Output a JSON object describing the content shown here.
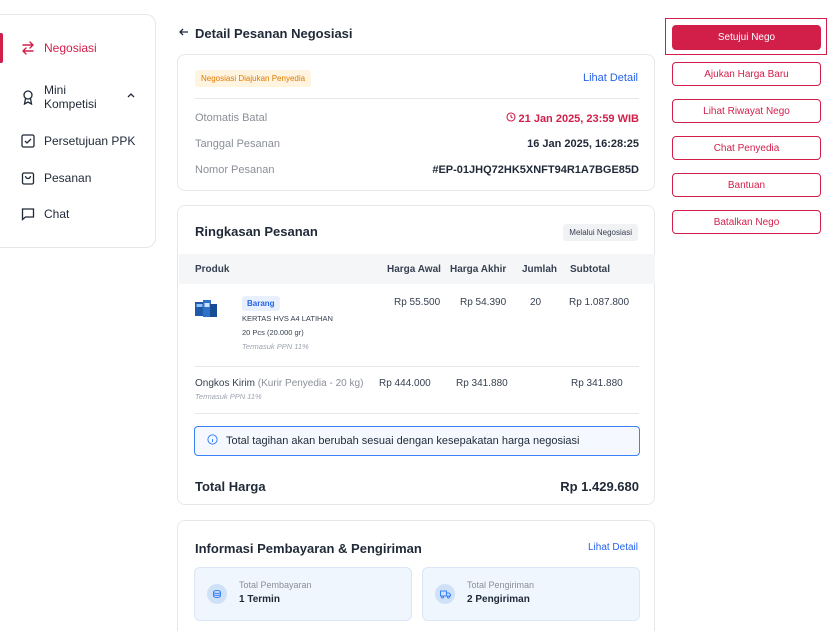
{
  "sidebar": {
    "items": [
      {
        "label": "Negosiasi",
        "icon": "swap-arrows-icon"
      },
      {
        "label": "Mini Kompetisi",
        "label_line1": "Mini",
        "label_line2": "Kompetisi",
        "icon": "ribbon-award-icon"
      },
      {
        "label": "Persetujuan PPK",
        "icon": "check-square-icon"
      },
      {
        "label": "Pesanan",
        "icon": "shopping-bag-icon"
      },
      {
        "label": "Chat",
        "icon": "chat-bubble-icon"
      }
    ]
  },
  "header": {
    "title": "Detail Pesanan Negosiasi"
  },
  "order_info": {
    "status_badge": "Negosiasi Diajukan Penyedia",
    "detail_link": "Lihat Detail",
    "rows": [
      {
        "label": "Otomatis Batal",
        "value": "21 Jan 2025, 23:59 WIB"
      },
      {
        "label": "Tanggal Pesanan",
        "value": "16 Jan 2025, 16:28:25"
      },
      {
        "label": "Nomor Pesanan",
        "value": "#EP-01JHQ72HK5XNFT94R1A7BGE85D"
      }
    ]
  },
  "summary": {
    "title": "Ringkasan Pesanan",
    "method_chip": "Melalui Negosiasi",
    "columns": [
      "Produk",
      "Harga Awal",
      "Harga Akhir",
      "Jumlah",
      "Subtotal"
    ],
    "product": {
      "tag": "Barang",
      "name": "KERTAS HVS A4 LATIHAN",
      "variant": "20 Pcs (20.000 gr)",
      "tax_note": "Termasuk PPN 11%",
      "harga_awal": "Rp 55.500",
      "harga_akhir": "Rp 54.390",
      "jumlah": "20",
      "subtotal": "Rp 1.087.800"
    },
    "shipping": {
      "label": "Ongkos Kirim",
      "courier": "(Kurir Penyedia - 20 kg)",
      "tax_note": "Termasuk PPN 11%",
      "harga_awal": "Rp 444.000",
      "harga_akhir": "Rp 341.880",
      "subtotal": "Rp 341.880"
    },
    "notice": "Total tagihan akan berubah sesuai dengan kesepakatan harga negosiasi",
    "total_label": "Total Harga",
    "total_value": "Rp 1.429.680"
  },
  "payment": {
    "title": "Informasi Pembayaran & Pengiriman",
    "detail_link": "Lihat Detail",
    "boxes": [
      {
        "label": "Total Pembayaran",
        "value": "1 Termin",
        "icon": "coins-icon"
      },
      {
        "label": "Total Pengiriman",
        "value": "2 Pengiriman",
        "icon": "truck-icon"
      }
    ]
  },
  "actions": {
    "approve": "Setujui Nego",
    "new_price": "Ajukan Harga Baru",
    "history": "Lihat Riwayat Nego",
    "chat": "Chat Penyedia",
    "help": "Bantuan",
    "cancel": "Batalkan Nego"
  },
  "colors": {
    "brand": "#d21f4a",
    "link": "#2563eb",
    "badge_orange": "#e07b00"
  }
}
